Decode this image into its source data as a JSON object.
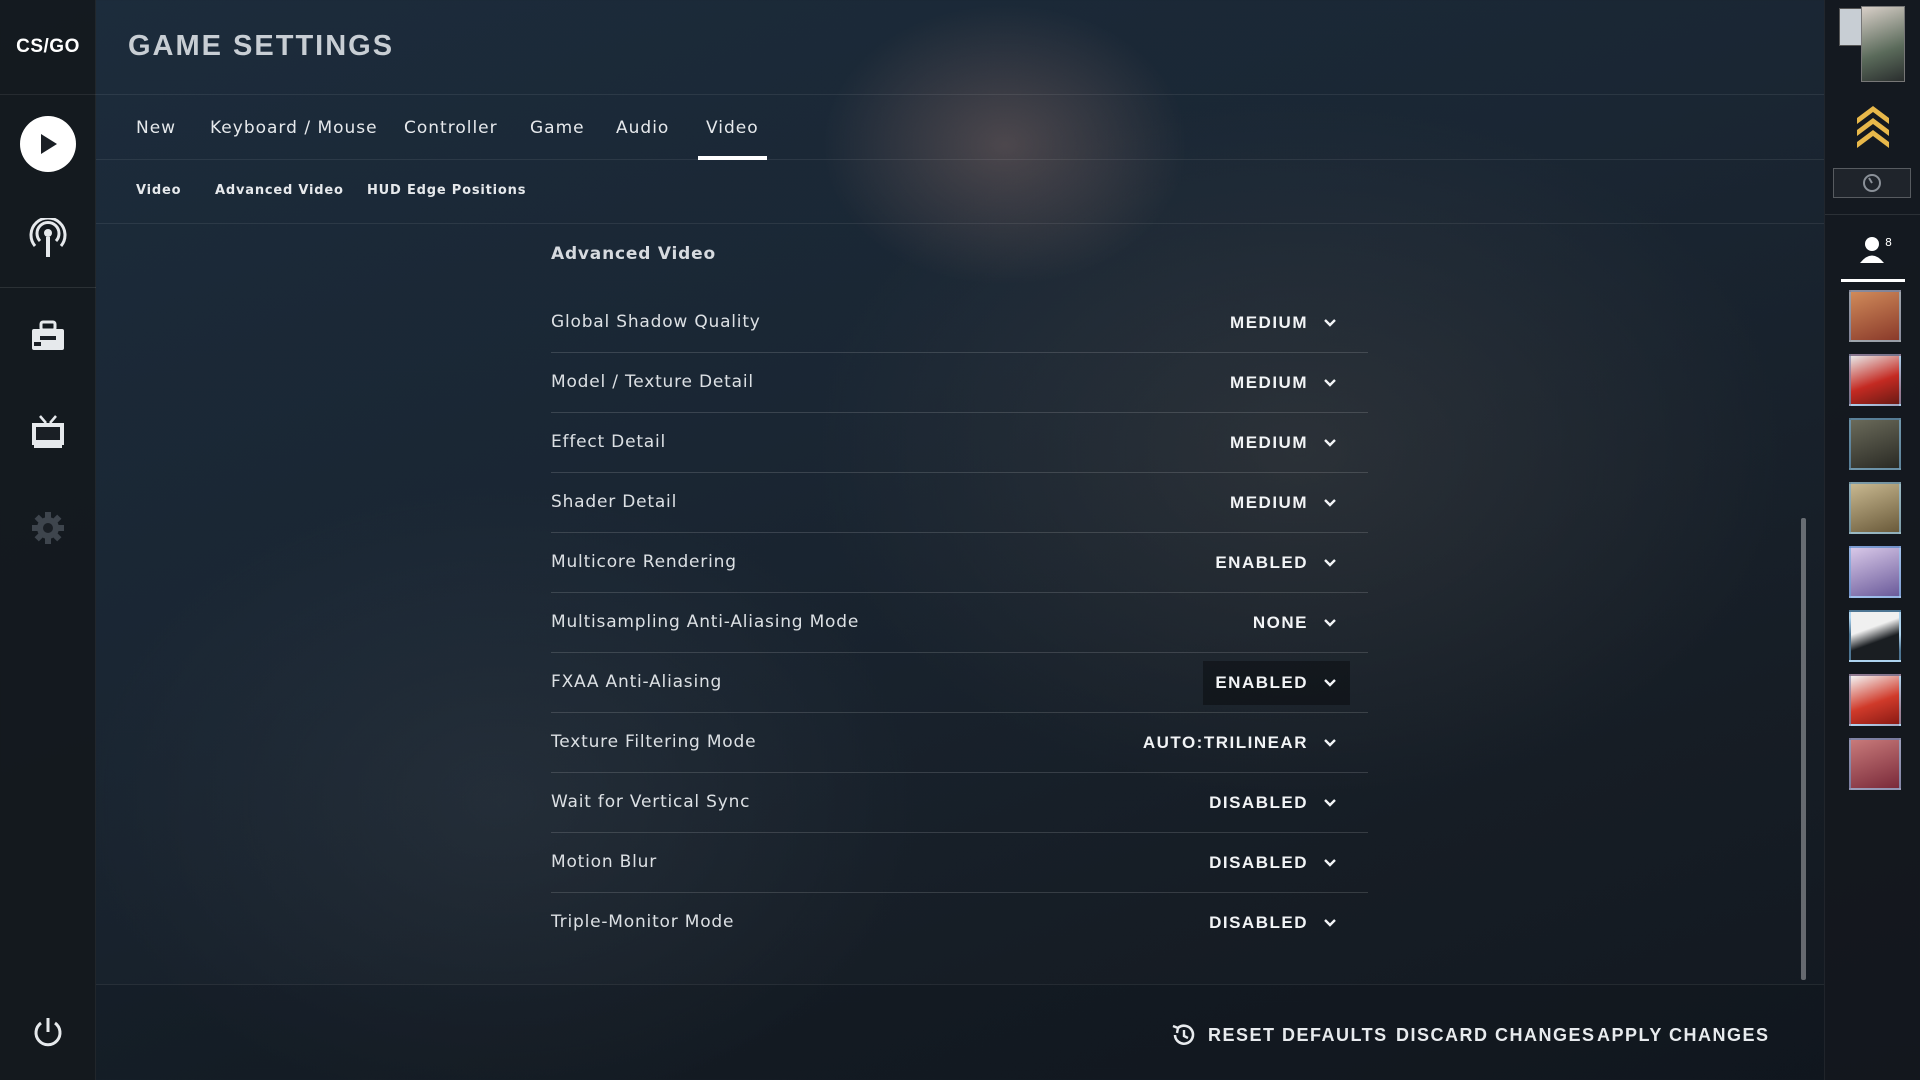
{
  "app": {
    "logo_text": "CS/GO"
  },
  "header": {
    "title": "GAME SETTINGS"
  },
  "tabs": [
    {
      "label": "New"
    },
    {
      "label": "Keyboard / Mouse"
    },
    {
      "label": "Controller"
    },
    {
      "label": "Game"
    },
    {
      "label": "Audio"
    },
    {
      "label": "Video",
      "active": true
    }
  ],
  "subtabs": [
    {
      "label": "Video"
    },
    {
      "label": "Advanced Video"
    },
    {
      "label": "HUD Edge Positions"
    }
  ],
  "section": {
    "title": "Advanced Video"
  },
  "settings": [
    {
      "label": "Global Shadow Quality",
      "value": "MEDIUM"
    },
    {
      "label": "Model / Texture Detail",
      "value": "MEDIUM"
    },
    {
      "label": "Effect Detail",
      "value": "MEDIUM"
    },
    {
      "label": "Shader Detail",
      "value": "MEDIUM"
    },
    {
      "label": "Multicore Rendering",
      "value": "ENABLED"
    },
    {
      "label": "Multisampling Anti-Aliasing Mode",
      "value": "NONE"
    },
    {
      "label": "FXAA Anti-Aliasing",
      "value": "ENABLED",
      "hovered": true
    },
    {
      "label": "Texture Filtering Mode",
      "value": "AUTO:TRILINEAR"
    },
    {
      "label": "Wait for Vertical Sync",
      "value": "DISABLED"
    },
    {
      "label": "Motion Blur",
      "value": "DISABLED"
    },
    {
      "label": "Triple-Monitor Mode",
      "value": "DISABLED"
    }
  ],
  "footer": {
    "reset_label": "RESET DEFAULTS",
    "discard_label": "DISCARD CHANGES",
    "apply_label": "APPLY CHANGES"
  },
  "left_nav": {
    "icons": [
      "play-icon",
      "broadcast-icon",
      "inventory-icon",
      "tv-icon",
      "gear-icon",
      "power-icon"
    ]
  },
  "friends": {
    "online_count": "8",
    "avatar_colors": [
      "#b46a4a",
      "#c42a22",
      "#4a4a42",
      "#9a8a5a",
      "#8a7ab0",
      "#2a2e34",
      "#c84a3a",
      "#8a3a4a"
    ]
  },
  "colors": {
    "accent": "#ffffff",
    "rank_gold": "#e8b84a"
  }
}
